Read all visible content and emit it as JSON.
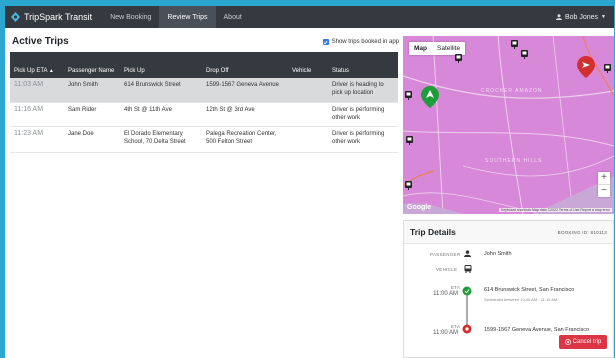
{
  "nav": {
    "brand": "TripSpark Transit",
    "links": [
      "New Booking",
      "Review Trips",
      "About"
    ],
    "user": "Bob Jones"
  },
  "trips": {
    "title": "Active Trips",
    "show_label": "Show trips booked in app",
    "columns": [
      "Pick Up ETA",
      "Passenger Name",
      "Pick Up",
      "Drop Off",
      "Vehicle",
      "Status"
    ],
    "sort_indicator": "▲",
    "rows": [
      {
        "eta": "11:03 AM",
        "name": "John Smith",
        "pickup": "614 Brunswick Street",
        "dropoff": "1599-1567 Geneva Avenue",
        "vehicle": "",
        "status": "Driver is heading to pick up location"
      },
      {
        "eta": "11:16 AM",
        "name": "Sam Rider",
        "pickup": "4th St @ 11th Ave",
        "dropoff": "12th St @ 3rd Ave",
        "vehicle": "",
        "status": "Driver is performing other work"
      },
      {
        "eta": "11:23 AM",
        "name": "Jane Doe",
        "pickup": "El Dorado Elementary School, 70 Delta Street",
        "dropoff": "Palega Recreation Center, 500 Felton Street",
        "vehicle": "",
        "status": "Driver is performing other work"
      }
    ]
  },
  "map": {
    "tabs": [
      "Map",
      "Satellite"
    ],
    "labels": [
      "CROCKER AMAZON",
      "SOUTHERN HILLS"
    ],
    "google": "Google",
    "attribution": "Keyboard shortcuts   Map data ©2022   Terms of Use   Report a map error",
    "zoom_in": "+",
    "zoom_out": "−"
  },
  "details": {
    "title": "Trip Details",
    "booking": "BOOKING ID: 810113",
    "passenger_label": "PASSENGER",
    "passenger": "John Smith",
    "vehicle_label": "VEHICLE",
    "eta_label": "ETA",
    "pickup_eta": "11:00 AM",
    "pickup": "614 Brunswick Street, San Francisco",
    "scheduled": "Scheduled between 10:45 AM - 11:15 AM",
    "dropoff_eta": "11:00 AM",
    "dropoff": "1599-1567 Geneva Avenue, San Francisco",
    "cancel": "Cancel trip"
  },
  "colors": {
    "navbar": "#353a40",
    "map": "#d888d8",
    "cancel": "#dc3545",
    "pickup_marker": "#1e9e3a",
    "dropoff_marker": "#d32f2f"
  }
}
